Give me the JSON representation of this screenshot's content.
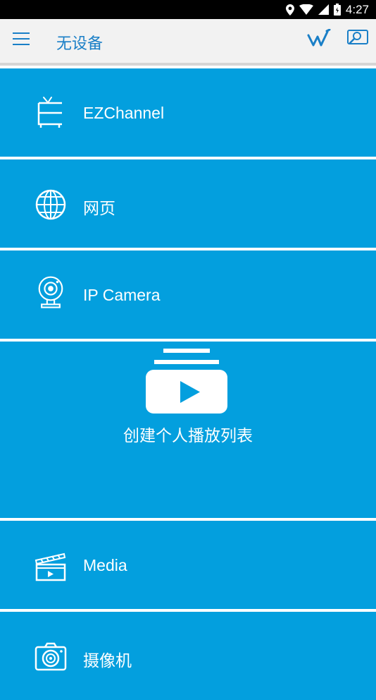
{
  "status_bar": {
    "time": "4:27"
  },
  "app_bar": {
    "title": "无设备"
  },
  "tiles": [
    {
      "label": "EZChannel",
      "icon": "tv-icon"
    },
    {
      "label": "网页",
      "icon": "globe-icon"
    },
    {
      "label": "IP Camera",
      "icon": "webcam-icon"
    },
    {
      "label": "创建个人播放列表",
      "icon": "playlist-icon"
    },
    {
      "label": "Media",
      "icon": "clapperboard-icon"
    },
    {
      "label": "摄像机",
      "icon": "camera-icon"
    }
  ],
  "colors": {
    "tile_bg": "#039fde",
    "appbar_bg": "#f2f2f2",
    "accent": "#1a7fc7"
  }
}
